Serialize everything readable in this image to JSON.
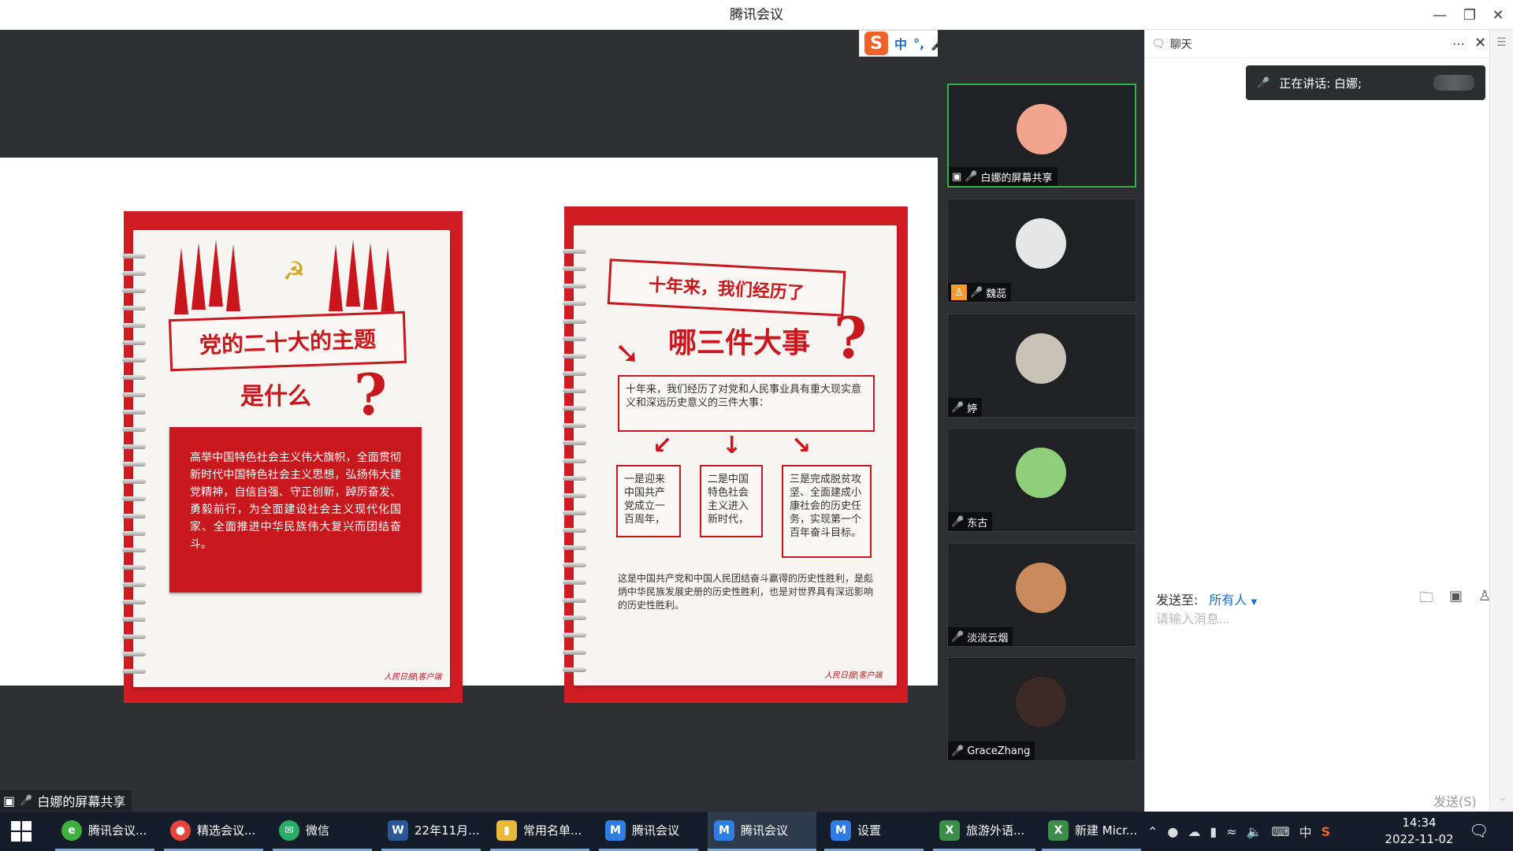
{
  "window": {
    "title": "腾讯会议"
  },
  "ime_toolbar": {
    "items": [
      "中",
      "°,",
      "🎤",
      "⌨",
      "👕",
      "⊞"
    ]
  },
  "slide_left": {
    "title": "党的二十大的主题",
    "subtitle": "是什么",
    "qmark": "?",
    "body": "高举中国特色社会主义伟大旗帜，全面贯彻新时代中国特色社会主义思想，弘扬伟大建党精神，自信自强、守正创新，踔厉奋发、勇毅前行，为全面建设社会主义现代化国家、全面推进中华民族伟大复兴而团结奋斗。",
    "logo": "人民日报|客户端"
  },
  "slide_right": {
    "title": "十年来，我们经历了",
    "subtitle": "哪三件大事",
    "qmark": "?",
    "intro": "十年来，我们经历了对党和人民事业具有重大现实意义和深远历史意义的三件大事：",
    "items": [
      "一是迎来中国共产党成立一百周年，",
      "二是中国特色社会主义进入新时代，",
      "三是完成脱贫攻坚、全面建成小康社会的历史任务，实现第一个百年奋斗目标。"
    ],
    "footer": "这是中国共产党和中国人民团结奋斗赢得的历史性胜利，是彪炳中华民族发展史册的历史性胜利，也是对世界具有深远影响的历史性胜利。",
    "logo": "人民日报|客户端"
  },
  "presenter_tag": "白娜的屏幕共享",
  "participants": [
    {
      "name": "白娜的屏幕共享",
      "muted": false,
      "sharing": true,
      "active": true,
      "avatar_color": "#f2a58e"
    },
    {
      "name": "魏蕊",
      "muted": true,
      "sharing": false,
      "active": false,
      "avatar_color": "#e6e6e6"
    },
    {
      "name": "婷",
      "muted": true,
      "sharing": false,
      "active": false,
      "avatar_color": "#c9c2b6"
    },
    {
      "name": "东古",
      "muted": false,
      "sharing": false,
      "active": false,
      "avatar_color": "#8fcf7a"
    },
    {
      "name": "淡淡云烟",
      "muted": true,
      "sharing": false,
      "active": false,
      "avatar_color": "#c98a5e"
    },
    {
      "name": "GraceZhang",
      "muted": false,
      "sharing": false,
      "active": false,
      "avatar_color": "#3b2a26"
    }
  ],
  "chat": {
    "header": "聊天",
    "speaking": "正在讲话: 白娜;",
    "sendto_label": "发送至:",
    "sendto_target": "所有人",
    "input_placeholder": "请输入消息...",
    "send_button": "发送(S)"
  },
  "taskbar": {
    "items": [
      {
        "label": "腾讯会议...",
        "icon_color": "#3cb13c",
        "icon_text": "e"
      },
      {
        "label": "精选会议...",
        "icon_color": "#e5463a",
        "icon_text": "●"
      },
      {
        "label": "微信",
        "icon_color": "#2aae67",
        "icon_text": "✉"
      },
      {
        "label": "22年11月...",
        "icon_color": "#2b5797",
        "icon_text": "W"
      },
      {
        "label": "常用名单...",
        "icon_color": "#e8b93a",
        "icon_text": "▮"
      },
      {
        "label": "腾讯会议",
        "icon_color": "#2f7de1",
        "icon_text": "M"
      },
      {
        "label": "腾讯会议",
        "icon_color": "#2f7de1",
        "icon_text": "M"
      },
      {
        "label": "设置",
        "icon_color": "#2f7de1",
        "icon_text": "M"
      },
      {
        "label": "旅游外语...",
        "icon_color": "#3a8e4a",
        "icon_text": "X"
      },
      {
        "label": "新建 Micr...",
        "icon_color": "#3a8e4a",
        "icon_text": "X"
      }
    ],
    "tray_ime": "中",
    "time": "14:34",
    "date": "2022-11-02"
  }
}
